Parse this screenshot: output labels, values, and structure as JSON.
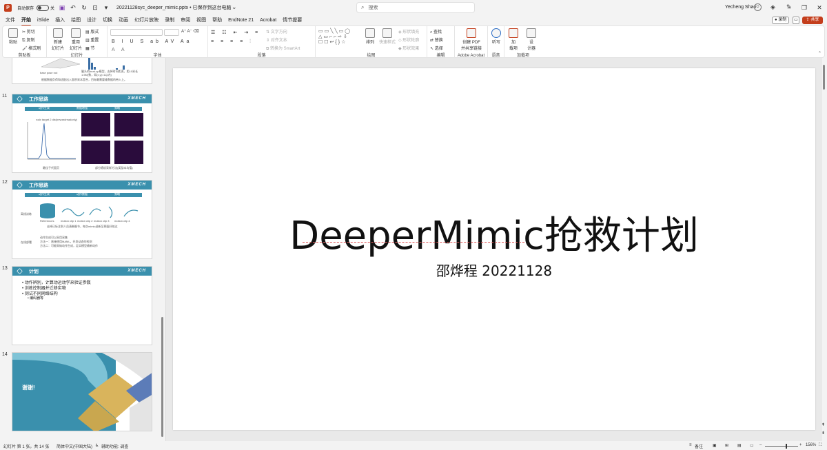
{
  "titlebar": {
    "autosave_label": "自动保存",
    "toggle_state": "关",
    "doc_title": "20221128syc_deeper_mimic.pptx • 已保存到这台电脑",
    "search_placeholder": "搜索",
    "user_name": "Yecheng Shao",
    "logo_letter": "P"
  },
  "menu": {
    "tabs": [
      "文件",
      "开始",
      "iSlide",
      "插入",
      "绘图",
      "设计",
      "切换",
      "动画",
      "幻灯片放映",
      "录制",
      "审阅",
      "视图",
      "帮助",
      "EndNote 21",
      "Acrobat",
      "情节提要"
    ],
    "active_index": 1,
    "record_label": "录制",
    "share_label": "共享"
  },
  "ribbon": {
    "clipboard": {
      "label": "剪贴板",
      "paste": "粘贴",
      "cut": "剪切",
      "copy": "复制",
      "format_painter": "格式刷"
    },
    "slides": {
      "label": "幻灯片",
      "new_slide": "新建\n幻灯片",
      "reuse": "重用\n幻灯片",
      "layout": "版式",
      "reset": "重置",
      "section": "节"
    },
    "font": {
      "label": "字体"
    },
    "paragraph": {
      "label": "段落",
      "text_direction": "文字方向",
      "align_text": "对齐文本",
      "smartart": "转换为 SmartArt"
    },
    "drawing": {
      "label": "绘图",
      "arrange": "排列",
      "quick_styles": "快速样式",
      "fill": "形状填充",
      "outline": "形状轮廓",
      "effects": "形状效果"
    },
    "editing": {
      "label": "编辑",
      "find": "查找",
      "replace": "替换",
      "select": "选择"
    },
    "acrobat": {
      "label": "Adobe Acrobat",
      "create_pdf": "创建 PDF\n并共享链接"
    },
    "voice": {
      "label": "语音",
      "dictate": "听写"
    },
    "addins": {
      "label": "加载项",
      "addins_btn": "加\n载项",
      "designer": "设\n计器"
    }
  },
  "thumbnails": [
    {
      "number": "",
      "caption_a": "base pose rod",
      "caption_b": "腿头的beat-up模型，去掉时间距离，距10米长",
      "caption_c": "1.5M(数，如(x,y)=1以内)",
      "caption_d": "根据数据负荷和适配出入面积采本是合，目标最需要维数据的带入上。"
    },
    {
      "number": "11",
      "title": "工作思路",
      "logo": "XMECH",
      "steps": [
        "动作生成",
        "数据增强",
        "策略"
      ],
      "plot_title": "rodx target 2 dist(rewardreadonly)",
      "caption_left": "最佳子代面页",
      "caption_right": "部分随机采样方法(奖励本均值)"
    },
    {
      "number": "12",
      "title": "工作思路",
      "logo": "XMECH",
      "steps": [
        "动作生成",
        "动作数据",
        "策略"
      ],
      "row1_label": "离线训练",
      "references": "References",
      "clips": [
        "motion clip 1",
        "motion clip 2",
        "motion clip 3",
        "motion clip 4"
      ],
      "caption_a": "去掉已标注到人员清晰细节，每次mimic送新至预面好效达",
      "row2_label": "在线部署",
      "deploy_lines": [
        "动作生成可以采用采集",
        "方法一：直接使用MAML，开发动态的检测",
        "方法二：可能采纳动作生成，定实模型输新动作"
      ]
    },
    {
      "number": "13",
      "title": "计划",
      "logo": "XMECH",
      "bullets": [
        "• 动作辨别，计算动运动学来验证参数",
        "• 训练控制器并迁移实物",
        "• 测试不同网络结构"
      ],
      "sub_bullet": "• 编码器等"
    },
    {
      "number": "14",
      "title": "谢谢!"
    }
  ],
  "slide": {
    "title": "DeeperMimic抢救计划",
    "subtitle": "邵烨程 20221128"
  },
  "status": {
    "slide_info": "幻灯片 第 1 张，共 14 张",
    "language": "简体中文(中国大陆)",
    "accessibility": "辅助功能: 调查",
    "notes": "备注",
    "zoom": "156%"
  },
  "colors": {
    "accent": "#c43e1c",
    "template_teal": "#3a90ad"
  }
}
